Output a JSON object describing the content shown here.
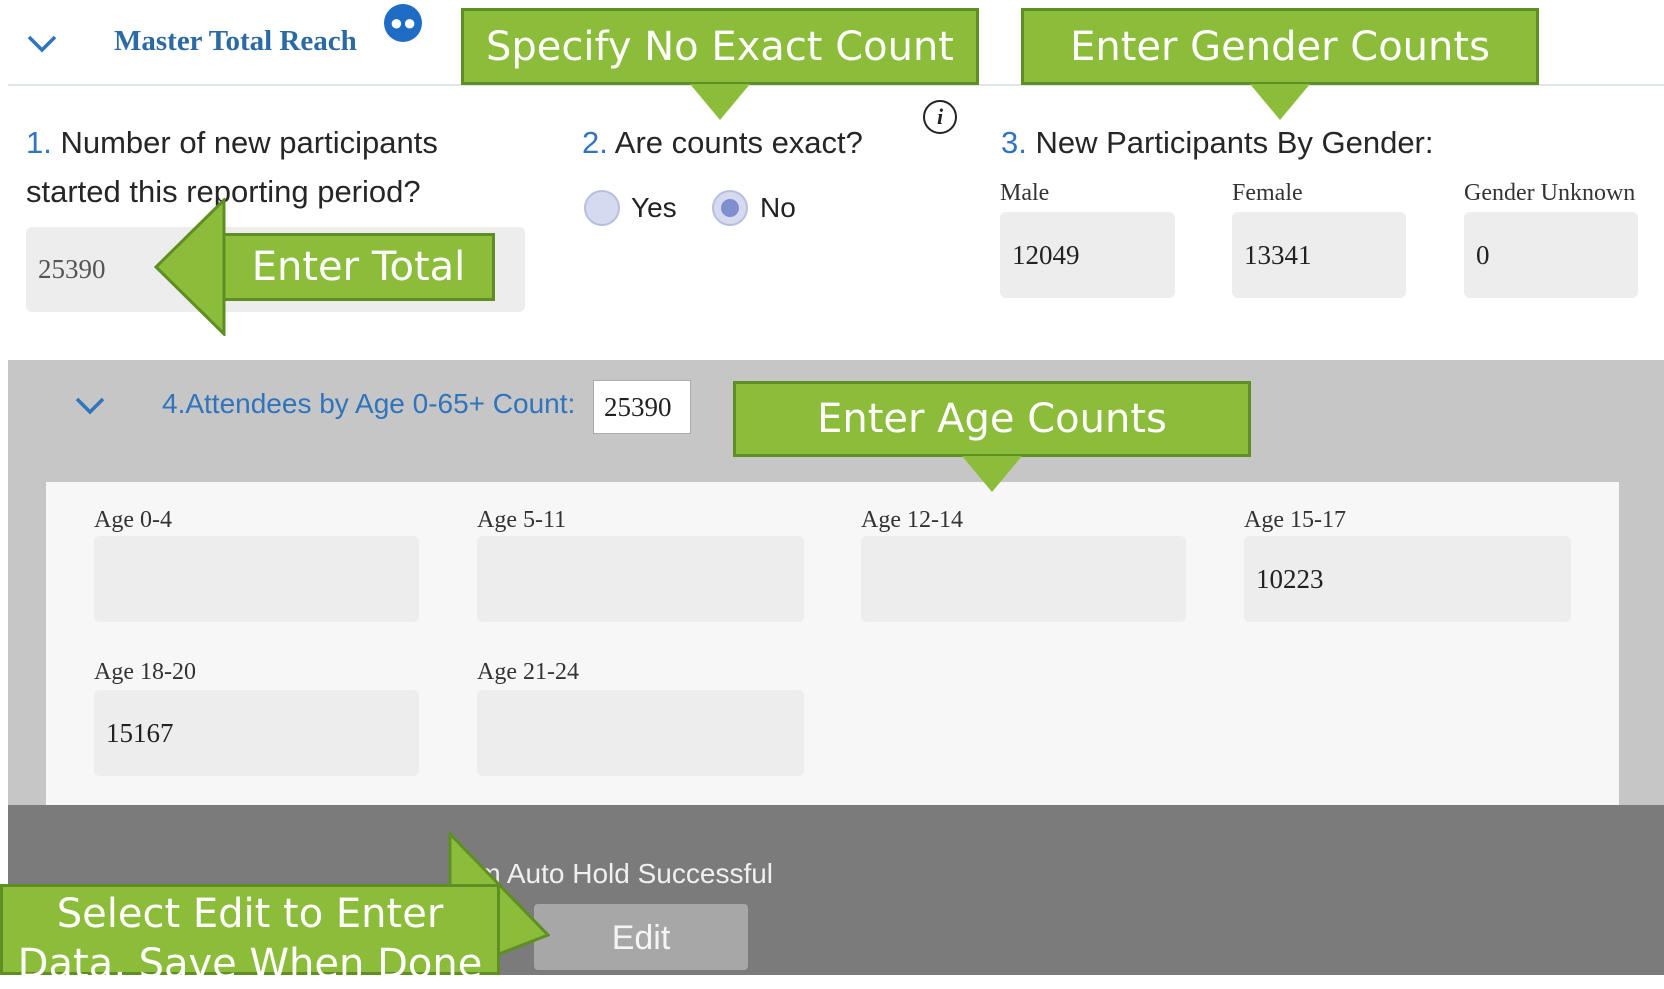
{
  "header": {
    "title": "Master Total Reach",
    "group_icon": "group-people-icon"
  },
  "q1": {
    "number": "1.",
    "label_line1": "Number of new participants",
    "label_line2": "started this reporting period?",
    "value": "25390"
  },
  "q2": {
    "number": "2.",
    "label": "Are counts exact?",
    "yes_label": "Yes",
    "no_label": "No",
    "selected": "No",
    "info_glyph": "i"
  },
  "q3": {
    "number": "3.",
    "label": "New Participants By Gender:",
    "male_label": "Male",
    "male_value": "12049",
    "female_label": "Female",
    "female_value": "13341",
    "unknown_label": "Gender Unknown",
    "unknown_value": "0"
  },
  "q4": {
    "title": "4.Attendees by Age 0-65+ Count:",
    "count": "25390",
    "ages": [
      {
        "label": "Age 0-4",
        "value": ""
      },
      {
        "label": "Age 5-11",
        "value": ""
      },
      {
        "label": "Age 12-14",
        "value": ""
      },
      {
        "label": "Age 15-17",
        "value": "10223"
      },
      {
        "label": "Age 18-20",
        "value": "15167"
      },
      {
        "label": "Age 21-24",
        "value": ""
      }
    ]
  },
  "footer": {
    "status": "rm Auto Hold Successful",
    "edit_label": "Edit"
  },
  "callouts": {
    "exact": "Specify No Exact Count",
    "gender": "Enter Gender Counts",
    "total": "Enter Total",
    "age": "Enter Age Counts",
    "edit_line1": "Select Edit to Enter",
    "edit_line2": "Data, Save When Done"
  },
  "colors": {
    "callout_green": "#8bbd3a",
    "accent_blue": "#2f74bd",
    "title_blue": "#2c6aa6"
  }
}
